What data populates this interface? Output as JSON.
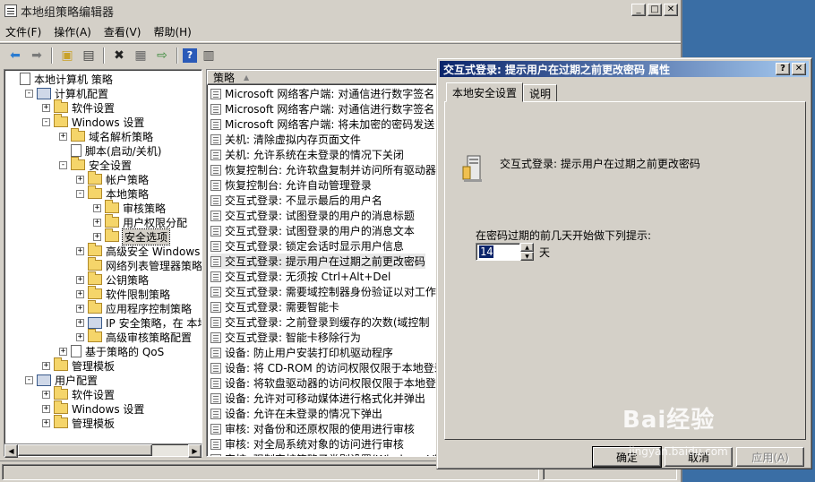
{
  "window": {
    "title": "本地组策略编辑器"
  },
  "menu": [
    "文件(F)",
    "操作(A)",
    "查看(V)",
    "帮助(H)"
  ],
  "toolbar_icons": [
    "back-icon",
    "forward-icon",
    "up-folder-icon",
    "show-tree-icon",
    "delete-icon",
    "properties-icon",
    "export-icon",
    "help-icon",
    "console-icon"
  ],
  "tree": [
    {
      "label": "本地计算机 策略",
      "level": 0,
      "icon": "book",
      "exp": ""
    },
    {
      "label": "计算机配置",
      "level": 1,
      "icon": "comp",
      "exp": "-"
    },
    {
      "label": "软件设置",
      "level": 2,
      "icon": "folder",
      "exp": "+"
    },
    {
      "label": "Windows 设置",
      "level": 2,
      "icon": "folder",
      "exp": "-"
    },
    {
      "label": "域名解析策略",
      "level": 3,
      "icon": "folder",
      "exp": "+"
    },
    {
      "label": "脚本(启动/关机)",
      "level": 3,
      "icon": "book",
      "exp": ""
    },
    {
      "label": "安全设置",
      "level": 3,
      "icon": "folder",
      "exp": "-"
    },
    {
      "label": "帐户策略",
      "level": 4,
      "icon": "folder",
      "exp": "+"
    },
    {
      "label": "本地策略",
      "level": 4,
      "icon": "folder",
      "exp": "-"
    },
    {
      "label": "审核策略",
      "level": 5,
      "icon": "folder",
      "exp": "+"
    },
    {
      "label": "用户权限分配",
      "level": 5,
      "icon": "folder",
      "exp": "+"
    },
    {
      "label": "安全选项",
      "level": 5,
      "icon": "folder",
      "exp": "+",
      "selected": true
    },
    {
      "label": "高级安全 Windows 防火",
      "level": 4,
      "icon": "folder",
      "exp": "+"
    },
    {
      "label": "网络列表管理器策略",
      "level": 4,
      "icon": "folder",
      "exp": ""
    },
    {
      "label": "公钥策略",
      "level": 4,
      "icon": "folder",
      "exp": "+"
    },
    {
      "label": "软件限制策略",
      "level": 4,
      "icon": "folder",
      "exp": "+"
    },
    {
      "label": "应用程序控制策略",
      "level": 4,
      "icon": "folder",
      "exp": "+"
    },
    {
      "label": "IP 安全策略，在 本地",
      "level": 4,
      "icon": "comp",
      "exp": "+"
    },
    {
      "label": "高级审核策略配置",
      "level": 4,
      "icon": "folder",
      "exp": "+"
    },
    {
      "label": "基于策略的 QoS",
      "level": 3,
      "icon": "book",
      "exp": "+"
    },
    {
      "label": "管理模板",
      "level": 2,
      "icon": "folder",
      "exp": "+"
    },
    {
      "label": "用户配置",
      "level": 1,
      "icon": "comp",
      "exp": "-"
    },
    {
      "label": "软件设置",
      "level": 2,
      "icon": "folder",
      "exp": "+"
    },
    {
      "label": "Windows 设置",
      "level": 2,
      "icon": "folder",
      "exp": "+"
    },
    {
      "label": "管理模板",
      "level": 2,
      "icon": "folder",
      "exp": "+"
    }
  ],
  "list": {
    "header": "策略",
    "rows": [
      "Microsoft 网络客户端: 对通信进行数字签名",
      "Microsoft 网络客户端: 对通信进行数字签名",
      "Microsoft 网络客户端: 将未加密的密码发送",
      "关机: 清除虚拟内存页面文件",
      "关机: 允许系统在未登录的情况下关闭",
      "恢复控制台: 允许软盘复制并访问所有驱动器",
      "恢复控制台: 允许自动管理登录",
      "交互式登录: 不显示最后的用户名",
      "交互式登录: 试图登录的用户的消息标题",
      "交互式登录: 试图登录的用户的消息文本",
      "交互式登录: 锁定会话时显示用户信息",
      "交互式登录: 提示用户在过期之前更改密码",
      "交互式登录: 无须按 Ctrl+Alt+Del",
      "交互式登录: 需要域控制器身份验证以对工作",
      "交互式登录: 需要智能卡",
      "交互式登录: 之前登录到缓存的次数(域控制",
      "交互式登录: 智能卡移除行为",
      "设备: 防止用户安装打印机驱动程序",
      "设备: 将 CD-ROM 的访问权限仅限于本地登录",
      "设备: 将软盘驱动器的访问权限仅限于本地登",
      "设备: 允许对可移动媒体进行格式化并弹出",
      "设备: 允许在未登录的情况下弹出",
      "审核: 对备份和还原权限的使用进行审核",
      "审核: 对全局系统对象的访问进行审核",
      "审核: 强制审核策略子类别设置(Windows Vi"
    ],
    "highlighted_index": 11
  },
  "dialog": {
    "title": "交互式登录: 提示用户在过期之前更改密码 属性",
    "tabs": [
      "本地安全设置",
      "说明"
    ],
    "policy_name": "交互式登录: 提示用户在过期之前更改密码",
    "prompt_label": "在密码过期的前几天开始做下列提示:",
    "days_value": "14",
    "days_unit": "天",
    "buttons": {
      "ok": "确定",
      "cancel": "取消",
      "apply": "应用(A)"
    }
  },
  "watermark": {
    "brand": "Bai经验",
    "url": "jingyan.baidu.com"
  }
}
